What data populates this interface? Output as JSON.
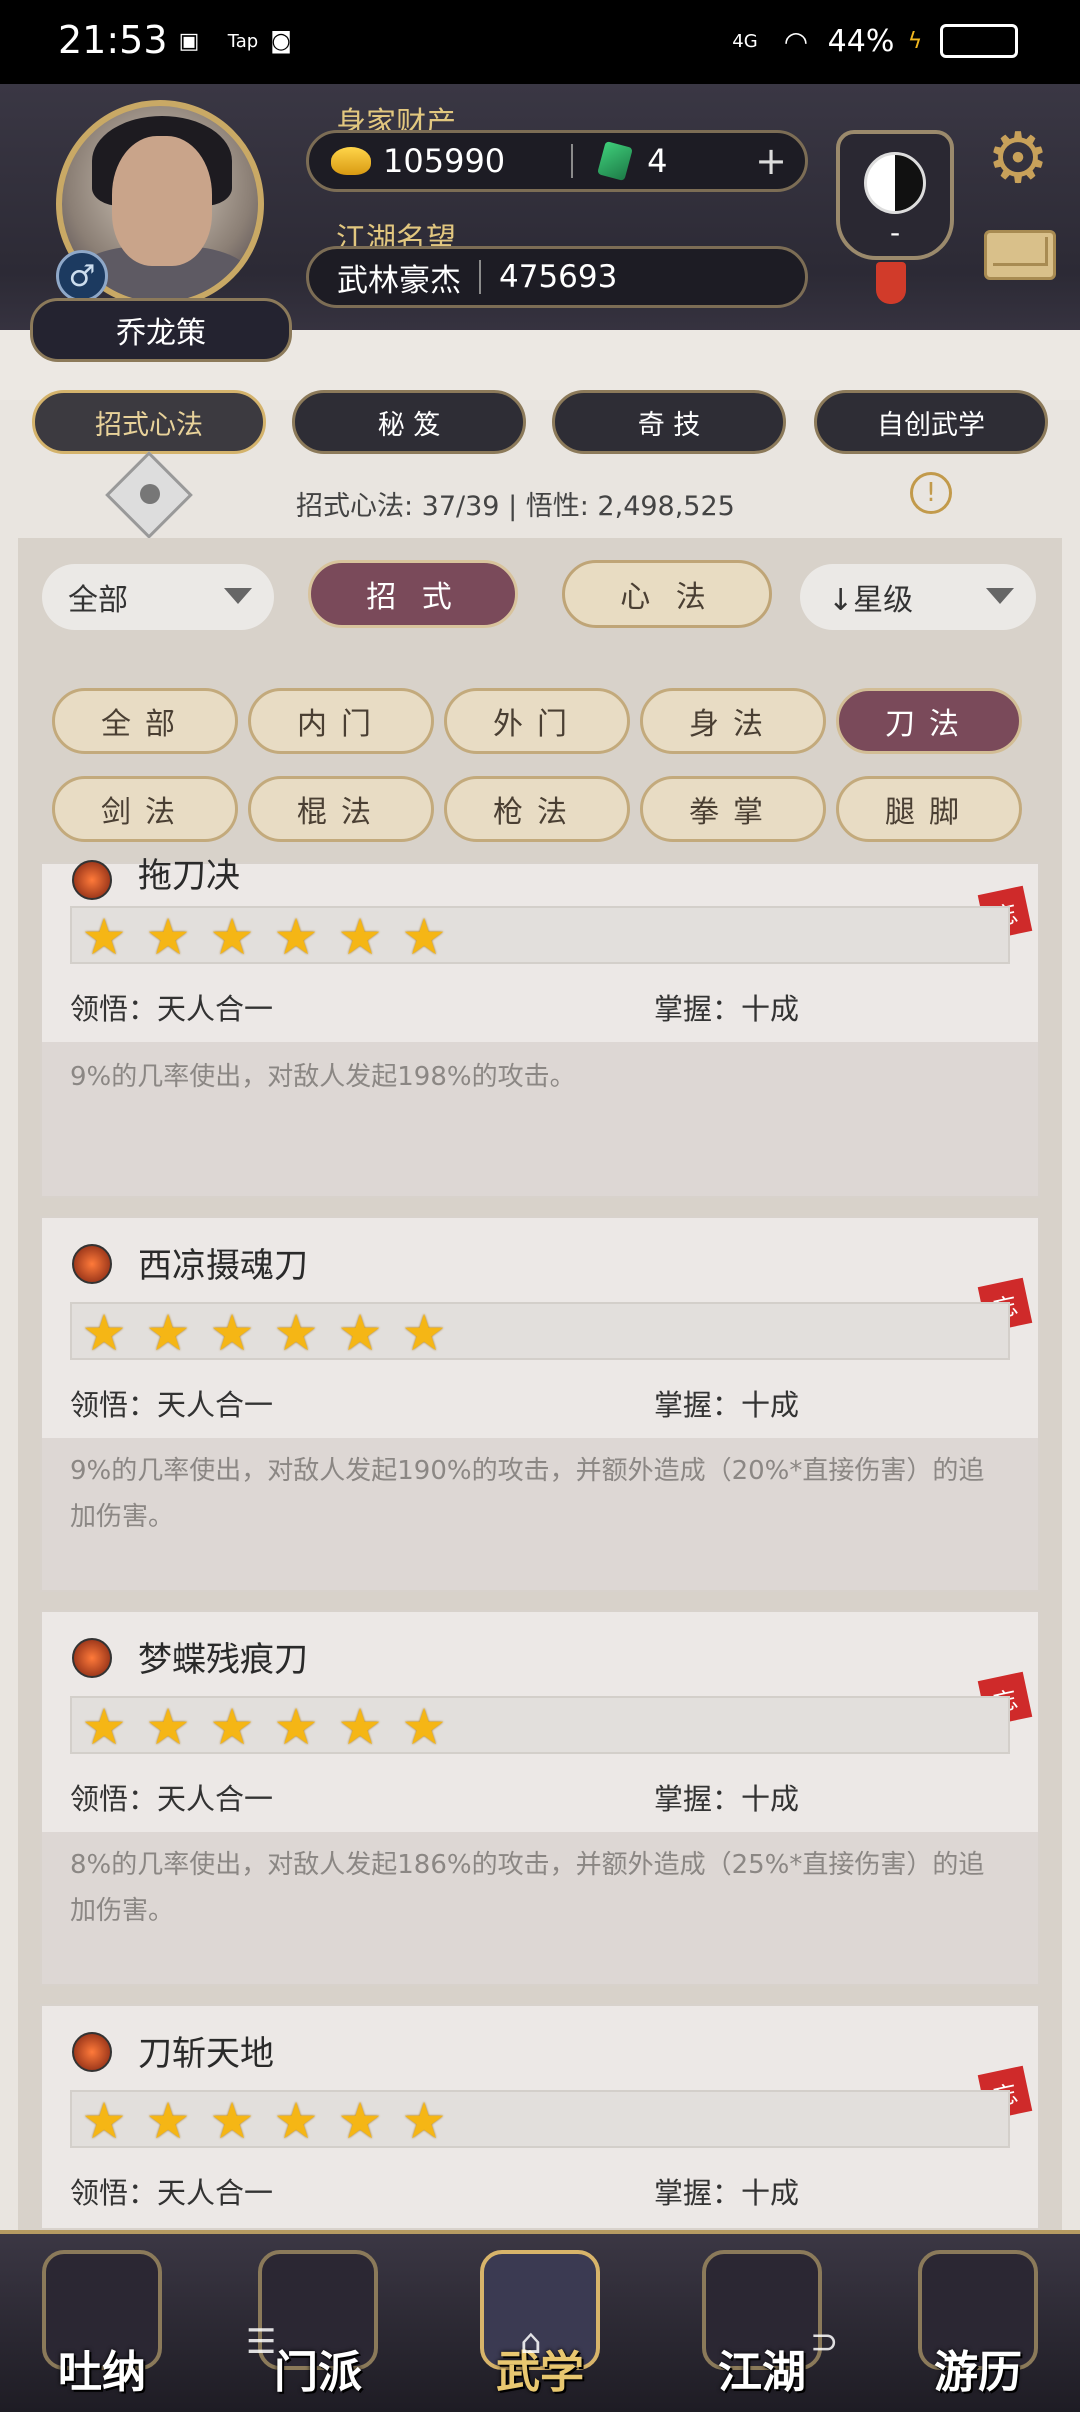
{
  "status_bar": {
    "time": "21:53",
    "tap_label": "Tap",
    "network": "4G",
    "battery": "44%"
  },
  "player": {
    "name": "乔龙策",
    "gender_symbol": "♂",
    "wealth_label": "身家财产",
    "gold": "105990",
    "jade": "4",
    "fame_label": "江湖名望",
    "fame_title": "武林豪杰",
    "fame_value": "475693"
  },
  "top_right": {
    "taiji_value": "-"
  },
  "main_tabs": [
    {
      "label": "招式心法",
      "active": true
    },
    {
      "label": "秘 笈",
      "active": false
    },
    {
      "label": "奇 技",
      "active": false
    },
    {
      "label": "自创武学",
      "active": false
    }
  ],
  "stats": {
    "text": "招式心法: 37/39  |  悟性: 2,498,525"
  },
  "filters": {
    "scope_dropdown": "全部",
    "type_tabs": [
      {
        "label": "招 式",
        "active": true
      },
      {
        "label": "心 法",
        "active": false
      }
    ],
    "sort_dropdown": "↓星级",
    "category_chips": [
      {
        "label": "全部",
        "active": false
      },
      {
        "label": "内门",
        "active": false
      },
      {
        "label": "外门",
        "active": false
      },
      {
        "label": "身法",
        "active": false
      },
      {
        "label": "刀法",
        "active": true
      },
      {
        "label": "剑法",
        "active": false
      },
      {
        "label": "棍法",
        "active": false
      },
      {
        "label": "枪法",
        "active": false
      },
      {
        "label": "拳掌",
        "active": false
      },
      {
        "label": "腿脚",
        "active": false
      }
    ]
  },
  "skills": [
    {
      "name": "拖刀决",
      "stars": 6,
      "comprehension": "领悟：天人合一",
      "mastery": "掌握：十成",
      "description": "9%的几率使出，对敌人发起198%的攻击。",
      "forget_label": "忘"
    },
    {
      "name": "西凉摄魂刀",
      "stars": 6,
      "comprehension": "领悟：天人合一",
      "mastery": "掌握：十成",
      "description": "9%的几率使出，对敌人发起190%的攻击，并额外造成（20%*直接伤害）的追加伤害。",
      "forget_label": "忘"
    },
    {
      "name": "梦蝶残痕刀",
      "stars": 6,
      "comprehension": "领悟：天人合一",
      "mastery": "掌握：十成",
      "description": "8%的几率使出，对敌人发起186%的攻击，并额外造成（25%*直接伤害）的追加伤害。",
      "forget_label": "忘"
    },
    {
      "name": "刀斩天地",
      "stars": 6,
      "comprehension": "领悟：天人合一",
      "mastery": "掌握：十成",
      "forget_label": "忘"
    }
  ],
  "bottom_nav": [
    {
      "label": "吐纳",
      "active": false
    },
    {
      "label": "门派",
      "active": false
    },
    {
      "label": "武学",
      "active": true
    },
    {
      "label": "江湖",
      "active": false
    },
    {
      "label": "游历",
      "active": false
    }
  ],
  "colors": {
    "accent_gold": "#c8a15a",
    "active_tab": "#7a4a5a",
    "star": "#f5b615"
  }
}
